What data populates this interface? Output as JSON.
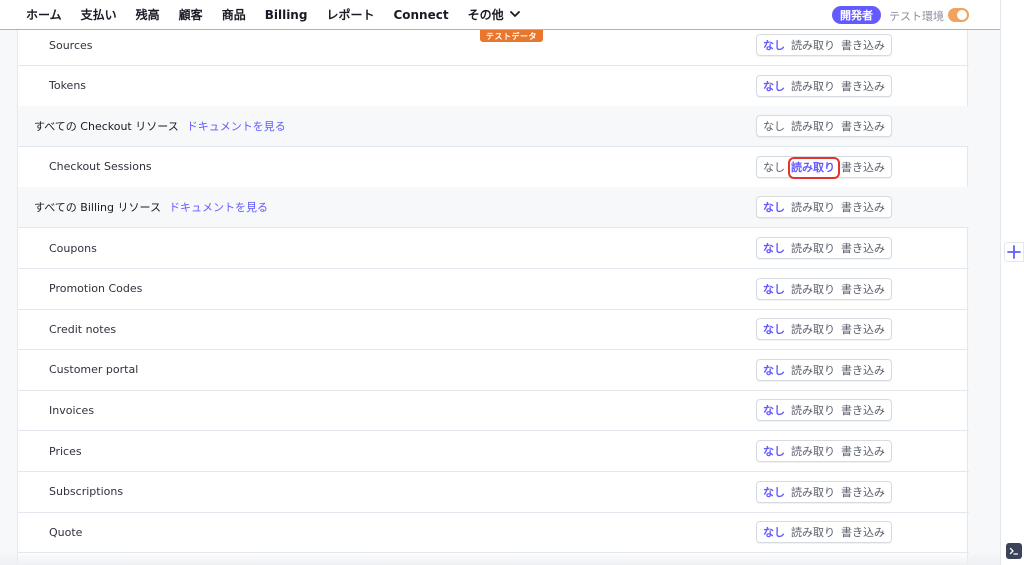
{
  "nav": {
    "items": [
      "ホーム",
      "支払い",
      "残高",
      "顧客",
      "商品",
      "Billing",
      "レポート",
      "Connect",
      "その他"
    ],
    "dev_badge": "開発者",
    "test_env_label": "テスト環境",
    "test_mode_on": true,
    "test_data_ribbon": "テストデータ"
  },
  "colors": {
    "accent": "#635bff",
    "test_orange": "#f0a35c",
    "highlight_red": "#e5322f"
  },
  "permission_labels": {
    "none": "なし",
    "read": "読み取り",
    "write": "書き込み"
  },
  "rows": [
    {
      "label": "Sources",
      "group": false,
      "selected": "none",
      "doc_link": ""
    },
    {
      "label": "Tokens",
      "group": false,
      "selected": "none",
      "doc_link": ""
    },
    {
      "label": "すべての Checkout リソース",
      "group": true,
      "selected": "",
      "doc_link": "ドキュメントを見る"
    },
    {
      "label": "Checkout Sessions",
      "group": false,
      "selected": "read",
      "doc_link": "",
      "highlighted": true
    },
    {
      "label": "すべての Billing リソース",
      "group": true,
      "selected": "none",
      "doc_link": "ドキュメントを見る"
    },
    {
      "label": "Coupons",
      "group": false,
      "selected": "none",
      "doc_link": ""
    },
    {
      "label": "Promotion Codes",
      "group": false,
      "selected": "none",
      "doc_link": ""
    },
    {
      "label": "Credit notes",
      "group": false,
      "selected": "none",
      "doc_link": ""
    },
    {
      "label": "Customer portal",
      "group": false,
      "selected": "none",
      "doc_link": ""
    },
    {
      "label": "Invoices",
      "group": false,
      "selected": "none",
      "doc_link": ""
    },
    {
      "label": "Prices",
      "group": false,
      "selected": "none",
      "doc_link": ""
    },
    {
      "label": "Subscriptions",
      "group": false,
      "selected": "none",
      "doc_link": ""
    },
    {
      "label": "Quote",
      "group": false,
      "selected": "none",
      "doc_link": ""
    }
  ],
  "icons": {
    "more_chevron": "chevron-down-icon",
    "side_add": "plus-icon",
    "console": "terminal-icon"
  }
}
